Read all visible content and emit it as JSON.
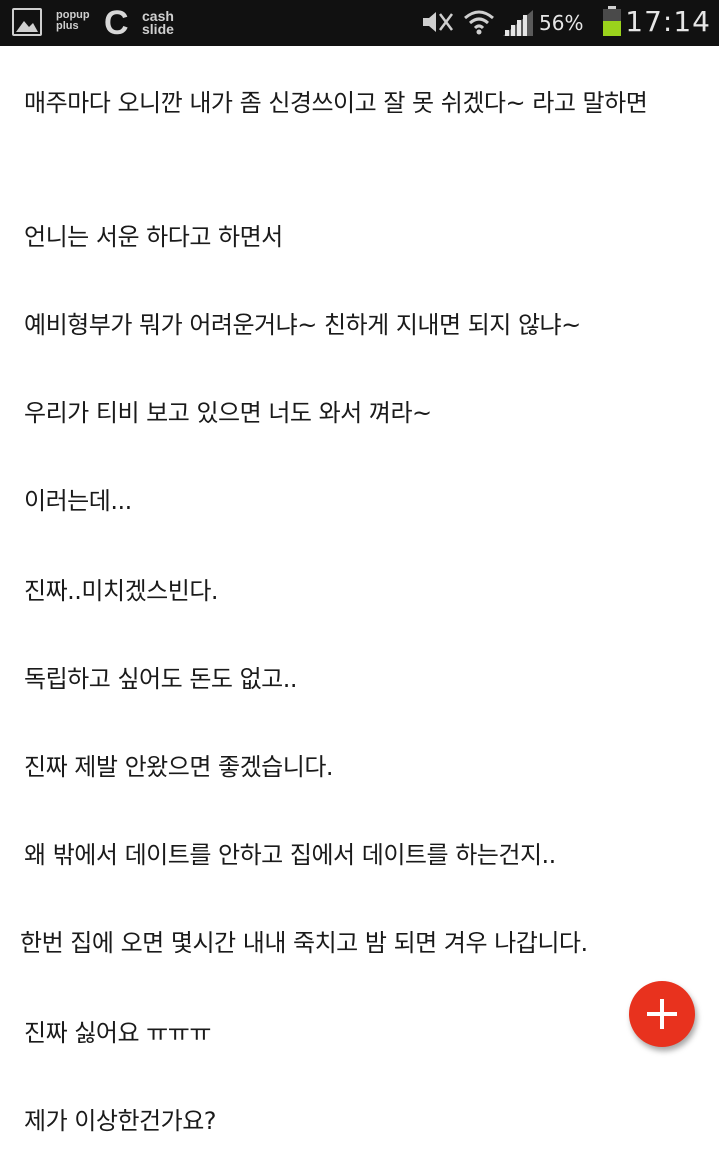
{
  "status_bar": {
    "left_icons": [
      "gallery-icon",
      "popup-plus-icon",
      "cash-slide-icon"
    ],
    "popup_plus_label": "popup plus",
    "cash_icon_glyph": "C",
    "cash_slide_label": "cash slide",
    "right_icons": [
      "mute-icon",
      "wifi-icon",
      "signal-icon",
      "battery-icon"
    ],
    "battery_percent": "56%",
    "battery_level": 0.56,
    "battery_color": "#9ad21c",
    "time": "17:14"
  },
  "post": {
    "lines": [
      "매주마다 오니깐 내가 좀 신경쓰이고 잘 못 쉬겠다~ 라고 말하면",
      "언니는 서운 하다고 하면서",
      "예비형부가 뭐가 어려운거냐~ 친하게 지내면 되지 않냐~",
      "우리가 티비 보고 있으면 너도 와서 껴라~",
      "이러는데...",
      "진짜..미치겠스빈다.",
      "독립하고 싶어도 돈도 없고..",
      "진짜 제발 안왔으면 좋겠습니다.",
      "왜 밖에서 데이트를 안하고 집에서 데이트를 하는건지..",
      "한번 집에 오면 몇시간 내내 죽치고 밤 되면 겨우 나갑니다.",
      "진짜 싫어요 ㅠㅠㅠ",
      "제가 이상한건가요?"
    ]
  },
  "fab": {
    "icon": "plus-icon",
    "color": "#e8321e"
  }
}
